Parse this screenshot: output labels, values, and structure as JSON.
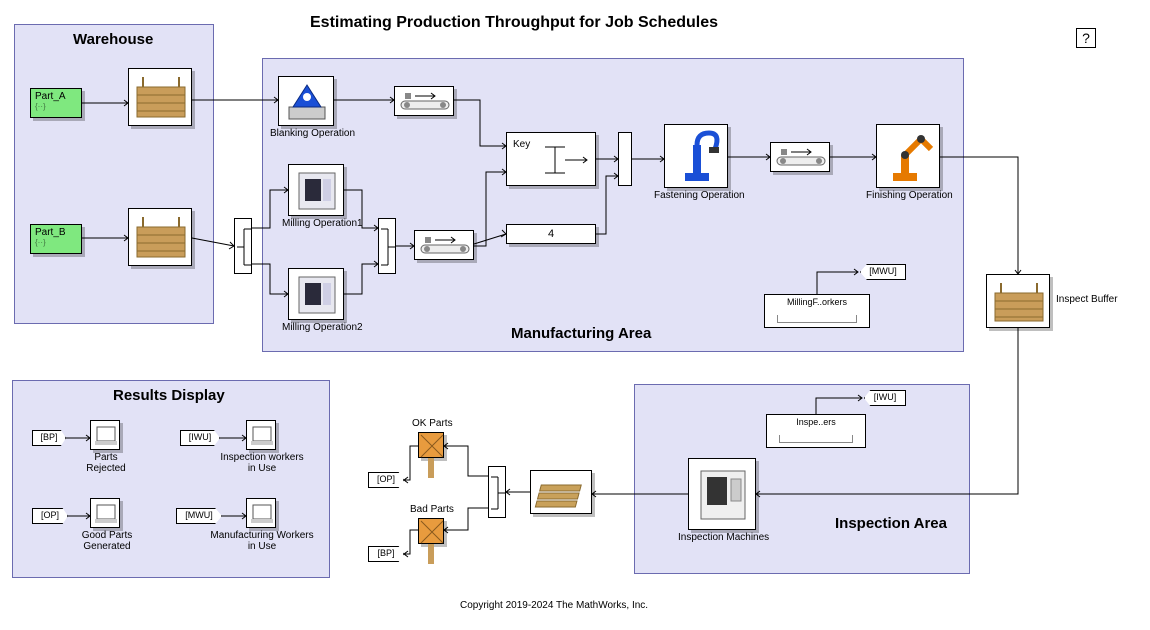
{
  "title": "Estimating Production Throughput for Job Schedules",
  "help_badge": "?",
  "copyright": "Copyright 2019-2024 The MathWorks, Inc.",
  "areas": {
    "warehouse": {
      "label": "Warehouse"
    },
    "manufacturing": {
      "label": "Manufacturing Area"
    },
    "inspection": {
      "label": "Inspection Area"
    },
    "results": {
      "label": "Results Display"
    }
  },
  "entity_generators": {
    "part_a": {
      "label": "Part_A"
    },
    "part_b": {
      "label": "Part_B"
    }
  },
  "blocks": {
    "blanking": {
      "label": "Blanking Operation"
    },
    "milling1": {
      "label": "Milling Operation1"
    },
    "milling2": {
      "label": "Milling Operation2"
    },
    "key_block": {
      "inner_label": "Key"
    },
    "fastening": {
      "label": "Fastening Operation"
    },
    "finishing": {
      "label": "Finishing Operation"
    },
    "capacity_block": {
      "inner_label": "4"
    },
    "inspect_buffer": {
      "label": "Inspect Buffer"
    },
    "inspect_machines": {
      "label": "Inspection Machines"
    },
    "ok_parts": {
      "label": "OK Parts"
    },
    "bad_parts": {
      "label": "Bad Parts"
    }
  },
  "resource_pools": {
    "milling_workers": {
      "label": "MillingF..orkers"
    },
    "inspectors": {
      "label": "Inspe..ers"
    }
  },
  "tags": {
    "mwu_out": "[MWU]",
    "iwu_out": "[IWU]",
    "bp_in": "[BP]",
    "op_in": "[OP]",
    "iwu_in": "[IWU]",
    "mwu_in": "[MWU]",
    "op_out": "[OP]",
    "bp_out": "[BP]"
  },
  "results": {
    "parts_rejected": "Parts Rejected",
    "good_parts": "Good Parts\nGenerated",
    "inspection_workers": "Inspection workers\nin Use",
    "mfg_workers": "Manufacturing Workers\nin Use"
  },
  "colors": {
    "area_bg": "#e2e2f6",
    "area_border": "#6b6bb0",
    "entity_green": "#7fe87f"
  }
}
